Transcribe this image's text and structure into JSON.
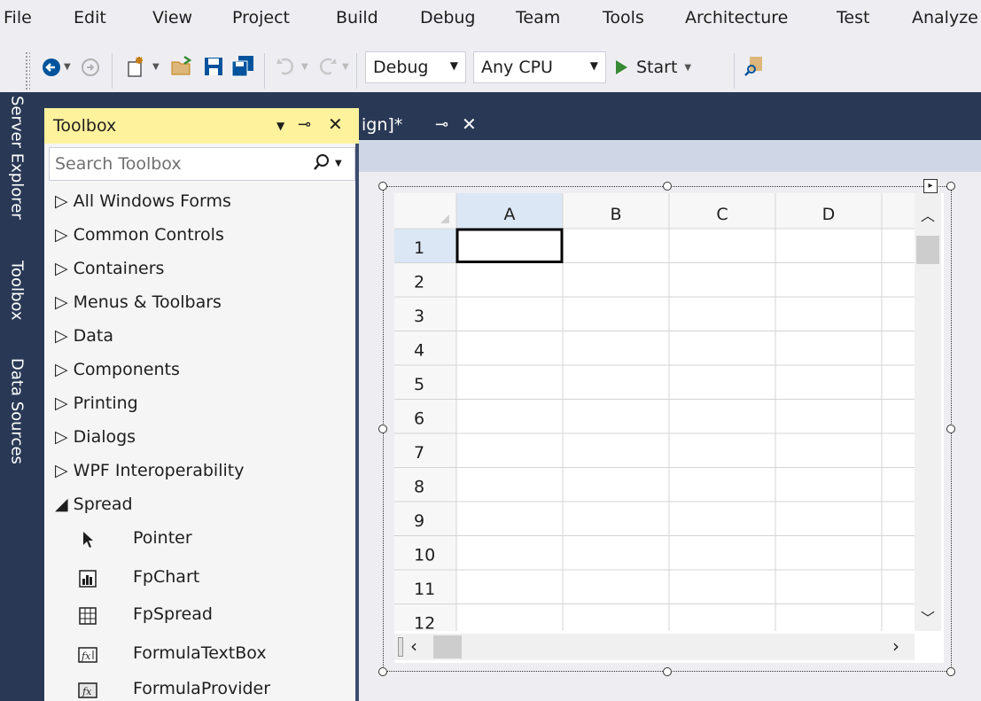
{
  "menu": [
    "File",
    "Edit",
    "View",
    "Project",
    "Build",
    "Debug",
    "Team",
    "Tools",
    "Architecture",
    "Test",
    "Analyze"
  ],
  "toolbar": {
    "config": "Debug",
    "platform": "Any CPU",
    "start": "Start"
  },
  "side_tabs": [
    "Server Explorer",
    "Toolbox",
    "Data Sources"
  ],
  "toolbox": {
    "title": "Toolbox",
    "search_placeholder": "Search Toolbox",
    "categories": [
      {
        "label": "All Windows Forms",
        "expanded": false
      },
      {
        "label": "Common Controls",
        "expanded": false
      },
      {
        "label": "Containers",
        "expanded": false
      },
      {
        "label": "Menus & Toolbars",
        "expanded": false
      },
      {
        "label": "Data",
        "expanded": false
      },
      {
        "label": "Components",
        "expanded": false
      },
      {
        "label": "Printing",
        "expanded": false
      },
      {
        "label": "Dialogs",
        "expanded": false
      },
      {
        "label": "WPF Interoperability",
        "expanded": false
      },
      {
        "label": "Spread",
        "expanded": true
      }
    ],
    "items": [
      {
        "label": "Pointer",
        "icon": "pointer-icon"
      },
      {
        "label": "FpChart",
        "icon": "chart-icon"
      },
      {
        "label": "FpSpread",
        "icon": "grid-icon"
      },
      {
        "label": "FormulaTextBox",
        "icon": "formula-icon"
      },
      {
        "label": "FormulaProvider",
        "icon": "formula-provider-icon"
      }
    ]
  },
  "document_tab": {
    "title": "ign]*"
  },
  "spread": {
    "columns": [
      "A",
      "B",
      "C",
      "D"
    ],
    "rows": [
      "1",
      "2",
      "3",
      "4",
      "5",
      "6",
      "7",
      "8",
      "9",
      "10",
      "11",
      "12"
    ],
    "active_cell": "A1"
  },
  "colors": {
    "shell": "#293955",
    "toolbox_title": "#fff29d",
    "selected_header": "#dbe7f4",
    "start_green": "#388a34"
  }
}
